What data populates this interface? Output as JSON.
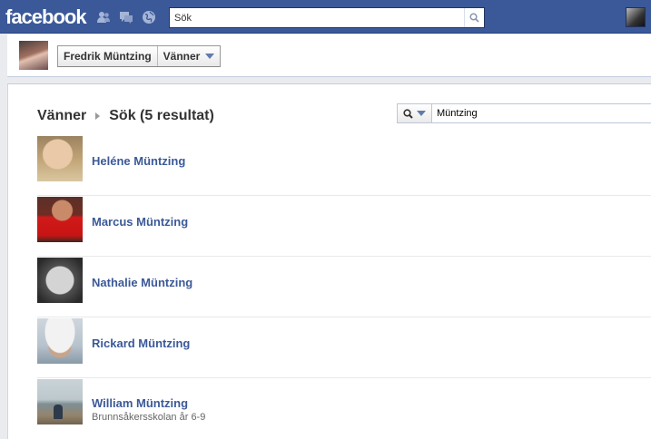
{
  "topbar": {
    "logo": "facebook",
    "search_value": "Sök",
    "icons": [
      "friend-requests-icon",
      "messages-icon",
      "notifications-globe-icon",
      "search-icon"
    ]
  },
  "profile": {
    "name": "Fredrik Müntzing",
    "section_button": "Vänner"
  },
  "breadcrumb": {
    "root": "Vänner",
    "current": "Sök (5 resultat)"
  },
  "filter": {
    "value": "Müntzing",
    "icons": [
      "search-icon",
      "chevron-down-icon"
    ]
  },
  "results": [
    {
      "name": "Heléne Müntzing",
      "sub": ""
    },
    {
      "name": "Marcus Müntzing",
      "sub": ""
    },
    {
      "name": "Nathalie Müntzing",
      "sub": ""
    },
    {
      "name": "Rickard Müntzing",
      "sub": ""
    },
    {
      "name": "William Müntzing",
      "sub": "Brunnsåkersskolan år 6-9"
    }
  ],
  "colors": {
    "brand": "#3b5998",
    "link": "#3b5998",
    "page_bg": "#e9ebee"
  }
}
